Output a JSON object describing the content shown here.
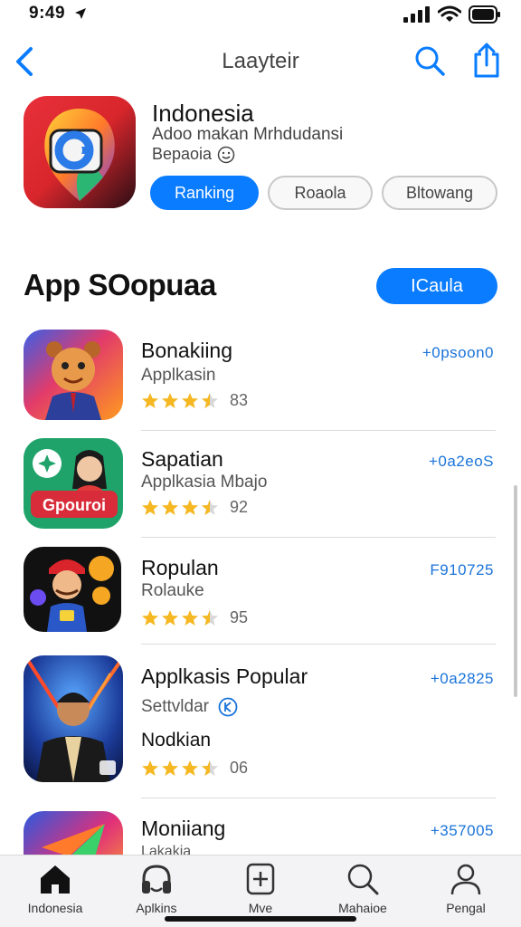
{
  "status": {
    "time": "9:49"
  },
  "nav": {
    "title": "Laayteir"
  },
  "featured": {
    "title": "Indonesia",
    "subtitle": "Adoo makan Mrhdudansi",
    "meta": "Bepaoia",
    "chips": [
      {
        "label": "Ranking",
        "active": true
      },
      {
        "label": "Roaola",
        "active": false
      },
      {
        "label": "Bltowang",
        "active": false
      }
    ]
  },
  "section": {
    "title": "App SOopuaa",
    "button_label": "ICaula"
  },
  "apps": [
    {
      "name": "Bonakiing",
      "subtitle": "Applkasin",
      "rating": 3.5,
      "rating_label": "83",
      "code": "+0psoon0"
    },
    {
      "name": "Sapatian",
      "subtitle": "Applkasia Mbajo",
      "rating": 3.5,
      "rating_label": "92",
      "code": "+0a2eoS"
    },
    {
      "name": "Ropulan",
      "subtitle": "Rolauke",
      "rating": 3.5,
      "rating_label": "95",
      "code": "F910725"
    },
    {
      "name": "Applkasis Popular",
      "subtitle": "Settvldar",
      "extra": "Nodkian",
      "rating": 3.5,
      "rating_label": "06",
      "code": "+0a2825"
    },
    {
      "name": "Moniiang",
      "subtitle": "Lakakia",
      "code": "+357005"
    }
  ],
  "tabs": [
    {
      "label": "Indonesia",
      "icon": "home-icon"
    },
    {
      "label": "Aplkins",
      "icon": "headphones-icon"
    },
    {
      "label": "Mve",
      "icon": "add-square-icon"
    },
    {
      "label": "Mahaioe",
      "icon": "search-icon"
    },
    {
      "label": "Pengal",
      "icon": "person-icon"
    }
  ],
  "colors": {
    "accent": "#0a7cff",
    "link": "#1a73d9",
    "star": "#f5b823"
  }
}
